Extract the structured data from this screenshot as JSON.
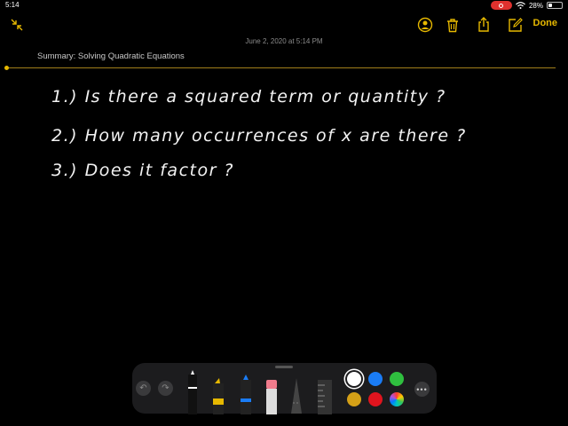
{
  "status_bar": {
    "time": "5:14",
    "battery": "28%",
    "battery_level": 0.28
  },
  "toolbar": {
    "done_label": "Done",
    "icons": [
      "collapse-icon",
      "collaborate-icon",
      "trash-icon",
      "share-icon",
      "compose-icon"
    ],
    "accent_color": "#e6b800"
  },
  "note": {
    "date": "June 2, 2020 at 5:14 PM",
    "title": "Summary: Solving Quadratic Equations",
    "lines": [
      "1.) Is there a squared term or quantity ?",
      "2.) How many occurrences of x are there ?",
      "3.) Does it factor ?"
    ]
  },
  "tool_palette": {
    "tools": [
      "pen",
      "marker",
      "pencil",
      "eraser",
      "lasso",
      "ruler"
    ],
    "colors": [
      "#ffffff",
      "#1a7cf5",
      "#2fbf3f",
      "#d4a017",
      "#e0141e"
    ]
  }
}
